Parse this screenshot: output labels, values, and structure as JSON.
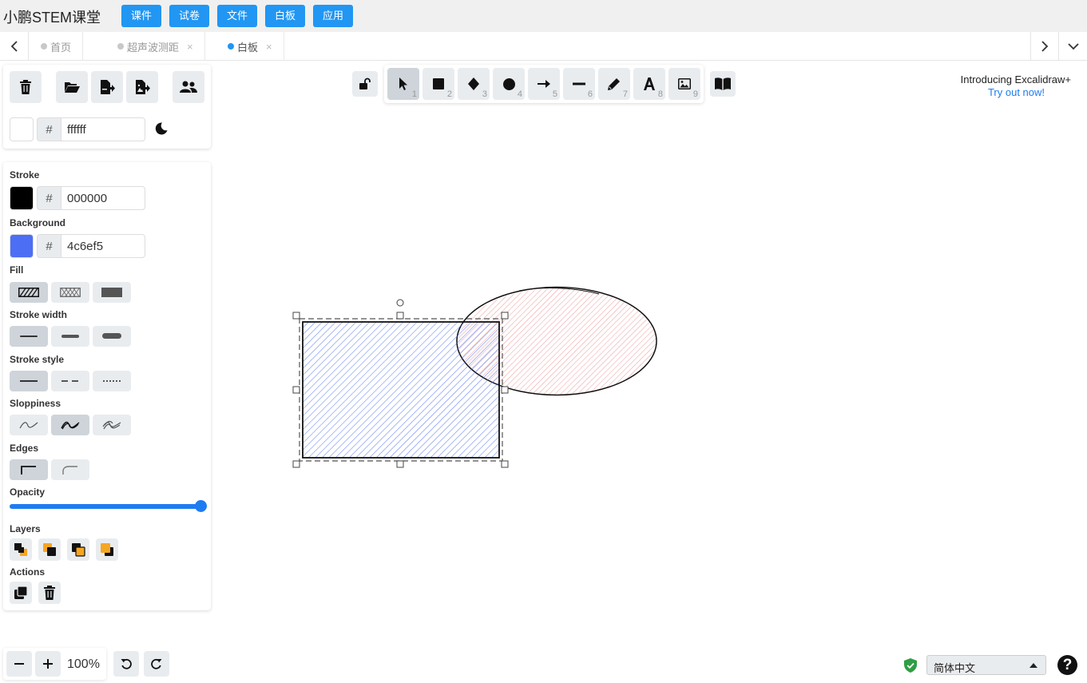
{
  "app": {
    "brand": "小鹏STEM课堂",
    "menu": [
      "课件",
      "试卷",
      "文件",
      "白板",
      "应用"
    ]
  },
  "tabs": [
    {
      "label": "首页",
      "closable": false,
      "active": false
    },
    {
      "label": "超声波测距",
      "closable": true,
      "active": false
    },
    {
      "label": "白板",
      "closable": true,
      "active": true
    }
  ],
  "canvas_panel": {
    "bg_hash": "#",
    "bg_hex": "ffffff",
    "bg_color": "#ffffff"
  },
  "props": {
    "stroke_label": "Stroke",
    "stroke_hash": "#",
    "stroke_hex": "000000",
    "stroke_color": "#000000",
    "background_label": "Background",
    "background_hash": "#",
    "background_hex": "4c6ef5",
    "background_color": "#4c6ef5",
    "fill_label": "Fill",
    "stroke_width_label": "Stroke width",
    "stroke_style_label": "Stroke style",
    "sloppiness_label": "Sloppiness",
    "edges_label": "Edges",
    "opacity_label": "Opacity",
    "opacity_value": 1.0,
    "layers_label": "Layers",
    "actions_label": "Actions"
  },
  "toolbar": {
    "shortcuts": [
      "1",
      "2",
      "3",
      "4",
      "5",
      "6",
      "7",
      "8",
      "9"
    ],
    "selected_tool": "selection"
  },
  "promo": {
    "title": "Introducing Excalidraw+",
    "link": "Try out now!"
  },
  "zoom": {
    "level": "100%"
  },
  "language": {
    "selected": "简体中文"
  },
  "help": {
    "label": "?"
  },
  "colors": {
    "accent": "#2196f3",
    "selected_bg": "#ced4da",
    "button_bg": "#e9ecef",
    "rect_hatch": "#4c6ef5",
    "ellipse_hatch": "#e03131"
  }
}
